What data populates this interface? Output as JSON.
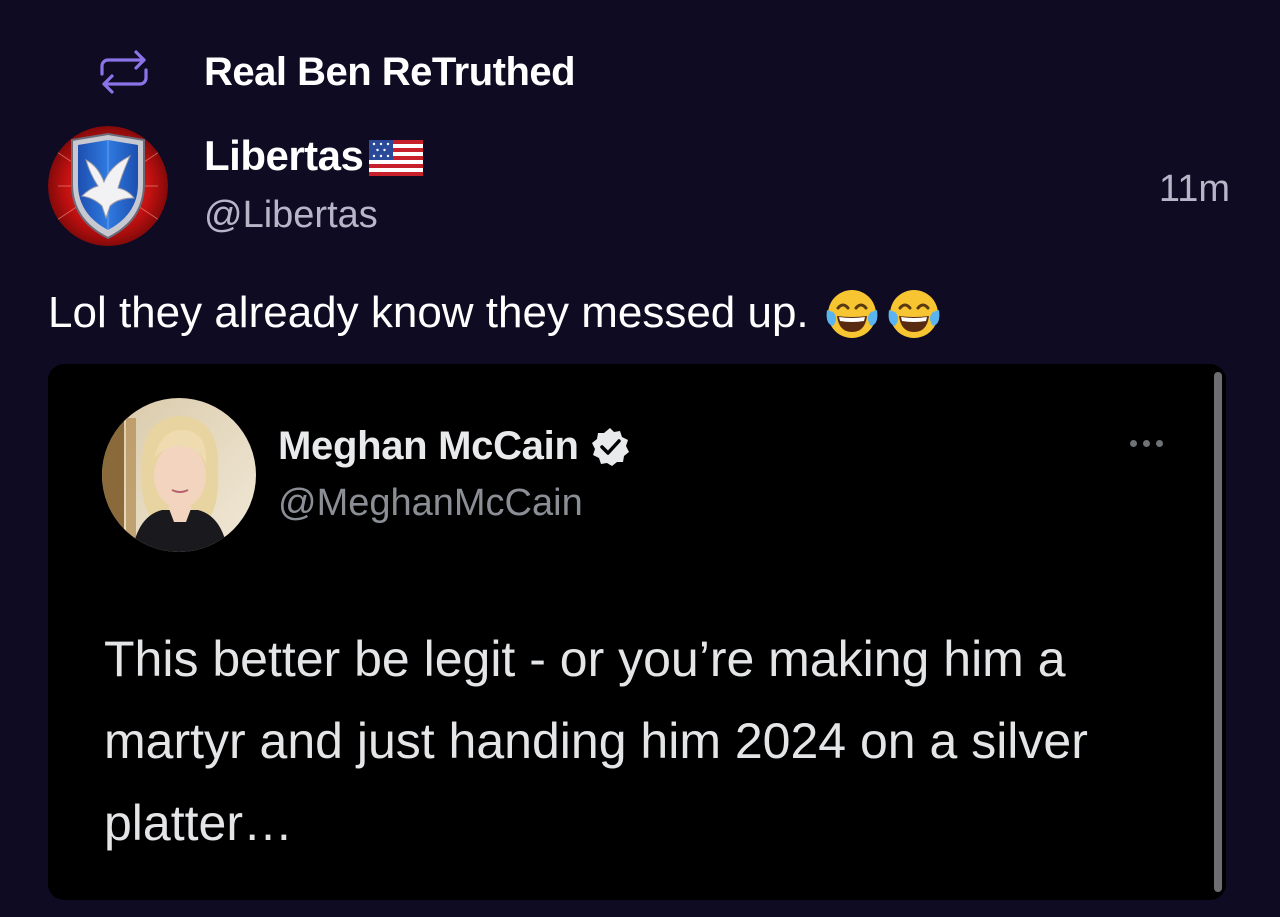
{
  "retruth": {
    "label": "Real Ben ReTruthed",
    "icon": "repost-arrows-icon",
    "accent": "#8b74e8"
  },
  "post": {
    "author": {
      "name": "Libertas",
      "handle": "@Libertas",
      "badge_icon": "us-flag-icon"
    },
    "timestamp": "11m",
    "text": "Lol they already know they messed up.",
    "emojis": [
      "tears-of-joy-emoji",
      "tears-of-joy-emoji"
    ]
  },
  "quoted_tweet": {
    "name": "Meghan McCain",
    "handle": "@MeghanMcCain",
    "verified_icon": "verified-check-icon",
    "more_icon": "more-dots-icon",
    "text": "This better be legit - or you’re making him a martyr and just handing him 2024 on a silver platter…"
  },
  "colors": {
    "background": "#0f0b22",
    "card_background": "#000000",
    "secondary_text": "#b9b5c8"
  }
}
